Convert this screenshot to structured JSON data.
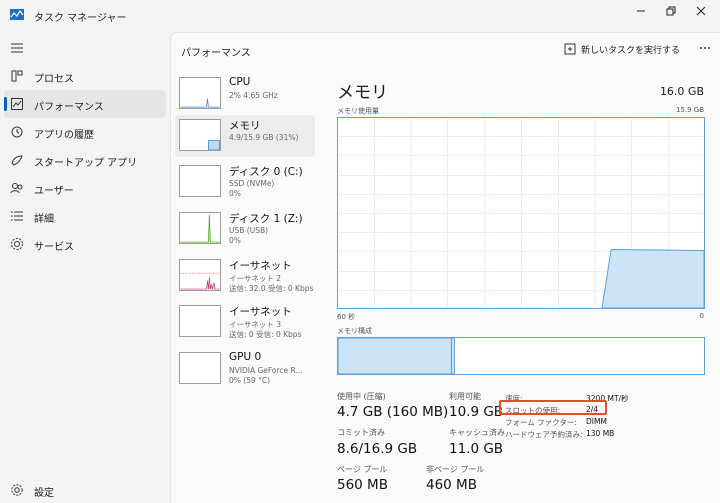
{
  "window": {
    "title": "タスク マネージャー"
  },
  "nav": {
    "items": [
      {
        "label": "プロセス",
        "icon": "processes-icon"
      },
      {
        "label": "パフォーマンス",
        "icon": "performance-icon",
        "active": true
      },
      {
        "label": "アプリの履歴",
        "icon": "history-icon"
      },
      {
        "label": "スタートアップ アプリ",
        "icon": "startup-icon"
      },
      {
        "label": "ユーザー",
        "icon": "users-icon"
      },
      {
        "label": "詳細",
        "icon": "details-icon"
      },
      {
        "label": "サービス",
        "icon": "services-icon"
      }
    ],
    "settings": "設定"
  },
  "header": {
    "title": "パフォーマンス",
    "run_task": "新しいタスクを実行する"
  },
  "devices": [
    {
      "name": "CPU",
      "sub1": "2%  4.65 GHz",
      "sub2": ""
    },
    {
      "name": "メモリ",
      "sub1": "4.9/15.9 GB (31%)",
      "sub2": ""
    },
    {
      "name": "ディスク 0 (C:)",
      "sub1": "SSD (NVMe)",
      "sub2": "0%"
    },
    {
      "name": "ディスク 1 (Z:)",
      "sub1": "USB (USB)",
      "sub2": "0%"
    },
    {
      "name": "イーサネット",
      "sub1": "イーサネット 2",
      "sub2": "送信: 32.0 受信: 0 Kbps"
    },
    {
      "name": "イーサネット",
      "sub1": "イーサネット 3",
      "sub2": "送信: 0 受信: 0 Kbps"
    },
    {
      "name": "GPU 0",
      "sub1": "NVIDIA GeForce R...",
      "sub2": "0% (59 °C)"
    }
  ],
  "detail": {
    "title": "メモリ",
    "total": "16.0 GB",
    "usage_label": "メモリ使用量",
    "usage_max": "15.9 GB",
    "axis_left": "60 秒",
    "axis_right": "0",
    "composition_label": "メモリ構成",
    "usage_history_fraction": 0.31,
    "in_use_fraction": 0.31
  },
  "stats": {
    "in_use_label": "使用中 (圧縮)",
    "in_use_value": "4.7 GB (160 MB)",
    "available_label": "利用可能",
    "available_value": "10.9 GB",
    "committed_label": "コミット済み",
    "committed_value": "8.6/16.9 GB",
    "cached_label": "キャッシュ済み",
    "cached_value": "11.0 GB",
    "paged_label": "ページ プール",
    "paged_value": "560 MB",
    "nonpaged_label": "非ページ プール",
    "nonpaged_value": "460 MB"
  },
  "kv": [
    {
      "key": "速度:",
      "value": "3200 MT/秒"
    },
    {
      "key": "スロットの使用:",
      "value": "2/4"
    },
    {
      "key": "フォーム ファクター:",
      "value": "DIMM"
    },
    {
      "key": "ハードウェア予約済み:",
      "value": "130 MB"
    }
  ],
  "colors": {
    "memory_fill": "#cce4f7",
    "memory_line": "#5d9fd8",
    "disk": "#4ca40c",
    "ethernet": "#c8307a",
    "highlight": "#e0502a"
  }
}
